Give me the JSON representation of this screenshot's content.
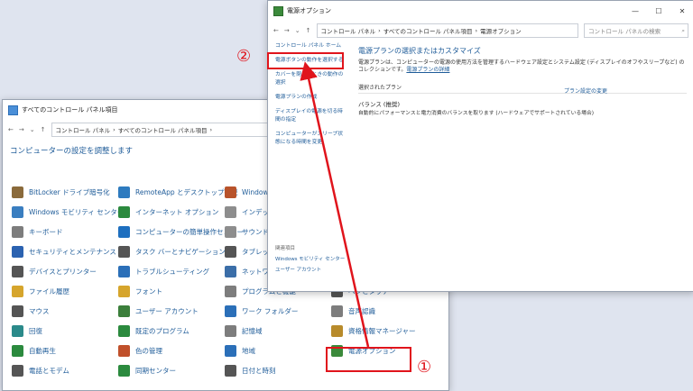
{
  "back_window": {
    "title": "すべてのコントロール パネル項目",
    "breadcrumb": [
      "コントロール パネル",
      "すべてのコントロール パネル項目"
    ],
    "heading": "コンピューターの設定を調整します",
    "items": [
      {
        "label": "BitLocker ドライブ暗号化",
        "color": "#8a6a3b"
      },
      {
        "label": "RemoteApp とデスクトップ接続",
        "color": "#2e7bbf"
      },
      {
        "label": "Windows ファイアウォール",
        "color": "#b8532b"
      },
      {
        "label": "Windows モビリティ センター",
        "color": "#3a7ec0"
      },
      {
        "label": "インターネット オプション",
        "color": "#2b8a3e"
      },
      {
        "label": "インデックス",
        "color": "#8d8d8d"
      },
      {
        "label": "キーボード",
        "color": "#7d7d7d"
      },
      {
        "label": "コンピューターの簡単操作センター",
        "color": "#1e6fbf"
      },
      {
        "label": "サウンド",
        "color": "#8d8d8d"
      },
      {
        "label": "セキュリティとメンテナンス",
        "color": "#2b62b0"
      },
      {
        "label": "タスク バーとナビゲーション",
        "color": "#555"
      },
      {
        "label": "タブレット",
        "color": "#555"
      },
      {
        "label": "デバイスとプリンター",
        "color": "#555"
      },
      {
        "label": "トラブルシューティング",
        "color": "#2b6fb8"
      },
      {
        "label": "ネットワーク",
        "color": "#3b6ea8"
      },
      {
        "label": "ファイル履歴",
        "color": "#d6a52c"
      },
      {
        "label": "フォント",
        "color": "#d6a52c"
      },
      {
        "label": "プログラムと機能",
        "color": "#7d7d7d"
      },
      {
        "label": "ペンとタッチ",
        "color": "#555"
      },
      {
        "label": "マウス",
        "color": "#555"
      },
      {
        "label": "ユーザー アカウント",
        "color": "#3b7f3b"
      },
      {
        "label": "ワーク フォルダー",
        "color": "#2b6fb8"
      },
      {
        "label": "音声認識",
        "color": "#7d7d7d"
      },
      {
        "label": "回復",
        "color": "#2b8a8a"
      },
      {
        "label": "既定のプログラム",
        "color": "#2b8a3e"
      },
      {
        "label": "記憶域",
        "color": "#7d7d7d"
      },
      {
        "label": "資格情報マネージャー",
        "color": "#b88b2b"
      },
      {
        "label": "自動再生",
        "color": "#2b8a3e"
      },
      {
        "label": "色の管理",
        "color": "#c0502b"
      },
      {
        "label": "地域",
        "color": "#2b6fb8"
      },
      {
        "label": "電源オプション",
        "color": "#3b8a3b"
      },
      {
        "label": "電話とモデム",
        "color": "#555"
      },
      {
        "label": "同期センター",
        "color": "#2b8a3e"
      },
      {
        "label": "日付と時刻",
        "color": "#555"
      }
    ]
  },
  "front_window": {
    "title": "電源オプション",
    "breadcrumb": [
      "コントロール パネル",
      "すべてのコントロール パネル項目",
      "電源オプション"
    ],
    "search_placeholder": "コントロール パネルの検索",
    "left_links": [
      "コントロール パネル ホーム",
      "電源ボタンの動作を選択する",
      "カバーを閉じたときの動作の選択",
      "電源プランの作成",
      "ディスプレイの電源を切る時間の指定",
      "コンピューターがスリープ状態になる時間を変更"
    ],
    "title_main": "電源プランの選択またはカスタマイズ",
    "desc": "電源プランは、コンピューターの電源の使用方法を管理するハードウェア設定とシステム設定 (ディスプレイのオフやスリープなど) のコレクションです。",
    "desc_link": "電源プランの詳細",
    "section": "選択されたプラン",
    "plan_name": "バランス (推奨)",
    "plan_desc": "自動的にパフォーマンスと電力消費のバランスを取ります (ハードウェアでサポートされている場合)",
    "plan_change": "プラン設定の変更",
    "related_title": "関連項目",
    "related": [
      "Windows モビリティ センター",
      "ユーザー アカウント"
    ]
  },
  "annotations": {
    "n1": "①",
    "n2": "②",
    "color": "#e0141c"
  }
}
